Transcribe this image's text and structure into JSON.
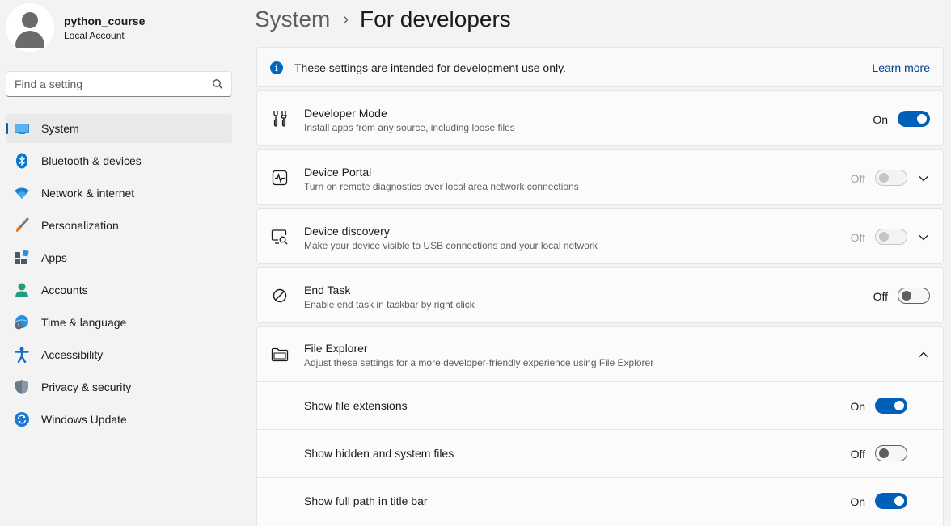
{
  "user": {
    "name": "python_course",
    "account_type": "Local Account"
  },
  "search": {
    "placeholder": "Find a setting"
  },
  "nav": [
    {
      "label": "System",
      "icon": "monitor-icon",
      "active": true
    },
    {
      "label": "Bluetooth & devices",
      "icon": "bluetooth-icon"
    },
    {
      "label": "Network & internet",
      "icon": "wifi-icon"
    },
    {
      "label": "Personalization",
      "icon": "brush-icon"
    },
    {
      "label": "Apps",
      "icon": "apps-icon"
    },
    {
      "label": "Accounts",
      "icon": "person-icon"
    },
    {
      "label": "Time & language",
      "icon": "globe-clock-icon"
    },
    {
      "label": "Accessibility",
      "icon": "accessibility-icon"
    },
    {
      "label": "Privacy & security",
      "icon": "shield-icon"
    },
    {
      "label": "Windows Update",
      "icon": "update-icon"
    }
  ],
  "breadcrumb": {
    "parent": "System",
    "separator": "›",
    "current": "For developers"
  },
  "info": {
    "text": "These settings are intended for development use only.",
    "link": "Learn more",
    "icon_glyph": "i"
  },
  "settings": {
    "developer_mode": {
      "title": "Developer Mode",
      "desc": "Install apps from any source, including loose files",
      "state": "On"
    },
    "device_portal": {
      "title": "Device Portal",
      "desc": "Turn on remote diagnostics over local area network connections",
      "state": "Off"
    },
    "device_discovery": {
      "title": "Device discovery",
      "desc": "Make your device visible to USB connections and your local network",
      "state": "Off"
    },
    "end_task": {
      "title": "End Task",
      "desc": "Enable end task in taskbar by right click",
      "state": "Off"
    },
    "file_explorer": {
      "title": "File Explorer",
      "desc": "Adjust these settings for a more developer-friendly experience using File Explorer",
      "items": [
        {
          "label": "Show file extensions",
          "state": "On"
        },
        {
          "label": "Show hidden and system files",
          "state": "Off"
        },
        {
          "label": "Show full path in title bar",
          "state": "On"
        }
      ]
    }
  },
  "colors": {
    "accent": "#005fb8",
    "background": "#f3f3f3",
    "card": "#fbfbfb"
  }
}
